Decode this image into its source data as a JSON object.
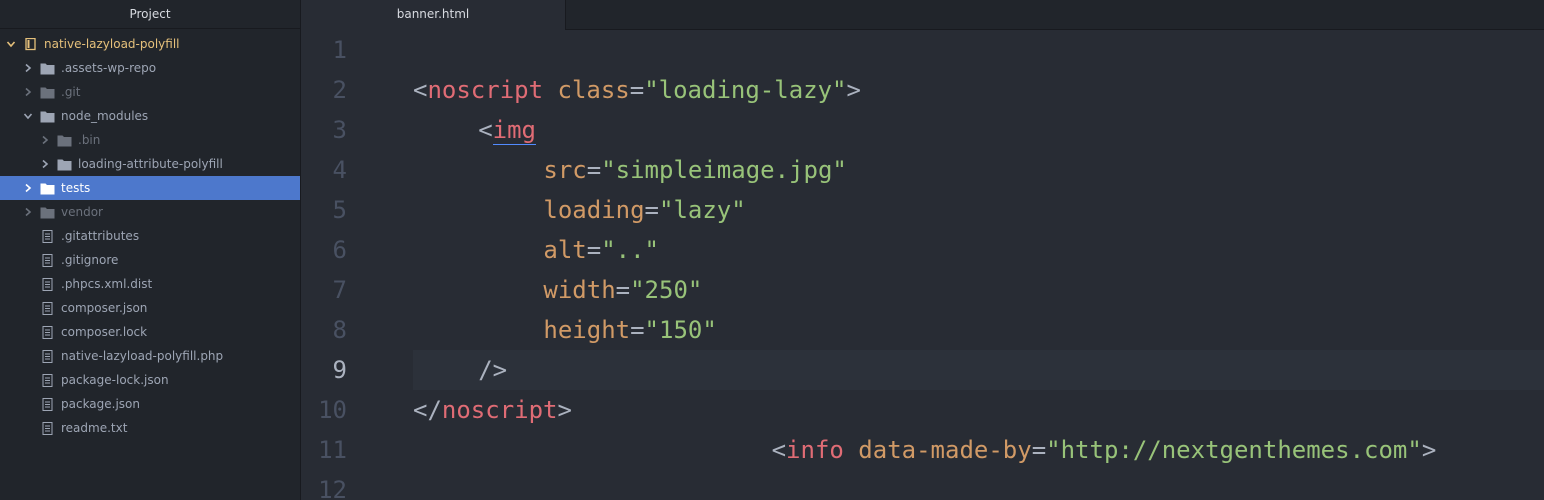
{
  "sidebar": {
    "title": "Project",
    "items": [
      {
        "label": "native-lazyload-polyfill",
        "kind": "root",
        "state": "open",
        "indent": 0
      },
      {
        "label": ".assets-wp-repo",
        "kind": "folder",
        "state": "closed",
        "indent": 1
      },
      {
        "label": ".git",
        "kind": "folder",
        "state": "closed",
        "indent": 1,
        "dim": true
      },
      {
        "label": "node_modules",
        "kind": "folder",
        "state": "open",
        "indent": 1
      },
      {
        "label": ".bin",
        "kind": "folder",
        "state": "closed",
        "indent": 2,
        "dim": true
      },
      {
        "label": "loading-attribute-polyfill",
        "kind": "folder",
        "state": "closed",
        "indent": 2
      },
      {
        "label": "tests",
        "kind": "folder",
        "state": "closed",
        "indent": 1,
        "selected": true
      },
      {
        "label": "vendor",
        "kind": "folder",
        "state": "closed",
        "indent": 1,
        "dim": true
      },
      {
        "label": ".gitattributes",
        "kind": "file",
        "indent": 1
      },
      {
        "label": ".gitignore",
        "kind": "file",
        "indent": 1
      },
      {
        "label": ".phpcs.xml.dist",
        "kind": "file",
        "indent": 1
      },
      {
        "label": "composer.json",
        "kind": "file",
        "indent": 1
      },
      {
        "label": "composer.lock",
        "kind": "file",
        "indent": 1
      },
      {
        "label": "native-lazyload-polyfill.php",
        "kind": "file",
        "indent": 1
      },
      {
        "label": "package-lock.json",
        "kind": "file",
        "indent": 1
      },
      {
        "label": "package.json",
        "kind": "file",
        "indent": 1
      },
      {
        "label": "readme.txt",
        "kind": "file",
        "indent": 1
      }
    ]
  },
  "tabs": [
    {
      "label": "banner.html",
      "active": true
    }
  ],
  "editor": {
    "active_line": 9,
    "lines": [
      {
        "number": "1",
        "indent": 0,
        "tokens": []
      },
      {
        "number": "2",
        "indent": 0,
        "tokens": [
          [
            "p",
            "<"
          ],
          [
            "t",
            "noscript"
          ],
          [
            "p",
            " "
          ],
          [
            "a",
            "class"
          ],
          [
            "p",
            "="
          ],
          [
            "s",
            "\"loading-lazy\""
          ],
          [
            "p",
            ">"
          ]
        ]
      },
      {
        "number": "3",
        "indent": 4,
        "tokens": [
          [
            "p",
            "<"
          ],
          [
            "t",
            "img"
          ]
        ]
      },
      {
        "number": "4",
        "indent": 8,
        "tokens": [
          [
            "a",
            "src"
          ],
          [
            "p",
            "="
          ],
          [
            "s",
            "\"simpleimage.jpg\""
          ]
        ]
      },
      {
        "number": "5",
        "indent": 8,
        "tokens": [
          [
            "a",
            "loading"
          ],
          [
            "p",
            "="
          ],
          [
            "s",
            "\"lazy\""
          ]
        ]
      },
      {
        "number": "6",
        "indent": 8,
        "tokens": [
          [
            "a",
            "alt"
          ],
          [
            "p",
            "="
          ],
          [
            "s",
            "\"..\""
          ]
        ]
      },
      {
        "number": "7",
        "indent": 8,
        "tokens": [
          [
            "a",
            "width"
          ],
          [
            "p",
            "="
          ],
          [
            "s",
            "\"250\""
          ]
        ]
      },
      {
        "number": "8",
        "indent": 8,
        "tokens": [
          [
            "a",
            "height"
          ],
          [
            "p",
            "="
          ],
          [
            "s",
            "\"150\""
          ]
        ]
      },
      {
        "number": "9",
        "indent": 4,
        "tokens": [
          [
            "p",
            "/>"
          ]
        ]
      },
      {
        "number": "10",
        "indent": 0,
        "tokens": [
          [
            "p",
            "</"
          ],
          [
            "t",
            "noscript"
          ],
          [
            "p",
            ">"
          ]
        ]
      },
      {
        "number": "11",
        "indent": 22,
        "tokens": [
          [
            "p",
            "<"
          ],
          [
            "t",
            "info"
          ],
          [
            "p",
            " "
          ],
          [
            "a",
            "data-made-by"
          ],
          [
            "p",
            "="
          ],
          [
            "s",
            "\"http://nextgenthemes.com\""
          ],
          [
            "p",
            ">"
          ]
        ]
      },
      {
        "number": "12",
        "indent": 0,
        "tokens": []
      }
    ]
  },
  "colors": {
    "selection": "#4d78cc",
    "tag": "#e06c75",
    "attribute": "#d19a66",
    "string": "#98c379",
    "punctuation": "#abb2bf"
  },
  "icons": {
    "folder": "folder-icon",
    "file": "file-icon",
    "repo": "repo-icon",
    "chevron_open": "chevron-down-icon",
    "chevron_closed": "chevron-right-icon"
  }
}
